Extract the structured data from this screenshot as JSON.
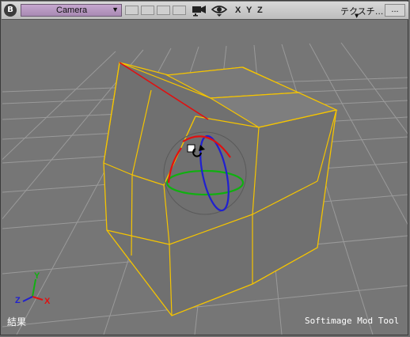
{
  "toolbar": {
    "b_button": "B",
    "camera_label": "Camera",
    "dropdown_arrow": "▼",
    "axis_x": "X",
    "axis_y": "Y",
    "axis_z": "Z",
    "texture_label": "テクスチ…",
    "more_label": "..."
  },
  "viewport": {
    "background": "#767676",
    "grid_color": "#9a9a9a",
    "selection_color": "#f5c400",
    "highlight_edge_color": "#e01010",
    "gizmo_colors": {
      "x": "#e01010",
      "y": "#10b010",
      "z": "#2020d0"
    }
  },
  "axis_gizmo": {
    "x": "X",
    "y": "Y",
    "z": "Z"
  },
  "status": {
    "left": "結果",
    "right": "Softimage Mod Tool"
  },
  "icons": [
    "camera-icon",
    "eye-icon",
    "rotate-cursor-icon",
    "axis-gizmo-icon"
  ]
}
